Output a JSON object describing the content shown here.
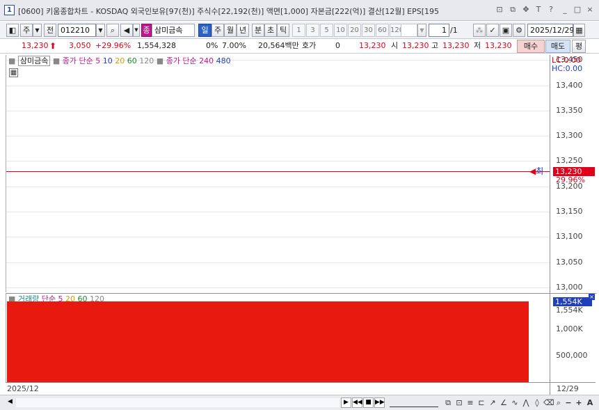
{
  "window": {
    "title": "[0600] 키움종합차트 - KOSDAQ 외국인보유[97(천)] 주식수[22,192(천)] 액면[1,000] 자본금[222(억)] 결산[12월] EPS[195",
    "icon_label": "1",
    "controls": [
      "?",
      "_",
      "□",
      "×"
    ]
  },
  "toolbar": {
    "market_label": "주",
    "prev_label": "전",
    "code": "012210",
    "stock_tag": "종",
    "stock_name": "삼미금속",
    "periods": [
      "일",
      "주",
      "월",
      "년",
      "분",
      "초",
      "틱"
    ],
    "active_period": "일",
    "intervals": [
      "1",
      "3",
      "5",
      "10",
      "20",
      "30",
      "60",
      "120"
    ],
    "page_current": "1",
    "page_total": "/1",
    "date": "2025/12/29"
  },
  "quote": {
    "price": "13,230",
    "change": "3,050",
    "change_pct": "+29.96%",
    "volume": "1,554,328",
    "ratio_pct": "0%",
    "rate2": "7.00%",
    "amount": "20,564백만",
    "hoga_label": "호가",
    "hoga_value": "0",
    "hoga_price": "13,230",
    "open_label": "시",
    "open": "13,230",
    "high_label": "고",
    "high": "13,230",
    "low_label": "저",
    "low": "13,230",
    "buy_label": "매수",
    "sell_label": "매도",
    "avg_label": "평"
  },
  "price_pane": {
    "stock_label": "삼미금속",
    "ma_label": "종가 단순",
    "ma_periods": [
      "5",
      "10",
      "20",
      "60",
      "120"
    ],
    "ma_label2": "종가 단순",
    "ma_periods2": [
      "240",
      "480"
    ],
    "lc_label": "LC:0.00",
    "hc_label": "HC:0.00",
    "current_marker": "최",
    "current_value": "13,230",
    "current_pct": "29.96%",
    "colors": {
      "price_line": "#e0001a",
      "tag_bg": "#e0001a"
    }
  },
  "volume_pane": {
    "title": "거래량",
    "ma_label": "단순",
    "ma_periods": [
      "5",
      "20",
      "60",
      "120"
    ],
    "current_badge": "1,554K",
    "current_label": "1,554K",
    "bar_color": "#e8190f"
  },
  "chart_data": [
    {
      "type": "line",
      "x": [
        "2025/12/29"
      ],
      "y": [
        13230
      ],
      "yticks": [
        "13,450",
        "13,400",
        "13,350",
        "13,300",
        "13,250",
        "13,200",
        "13,150",
        "13,100",
        "13,050",
        "13,000"
      ],
      "ylim": [
        12990,
        13460
      ]
    },
    {
      "type": "bar",
      "categories": [
        "2025/12/29"
      ],
      "values": [
        1554328
      ],
      "yticks": [
        "1,000K",
        "500,000"
      ],
      "ylim": [
        0,
        1700000
      ]
    }
  ],
  "axis": {
    "x_start": "2025/12",
    "x_end": "12/29"
  }
}
